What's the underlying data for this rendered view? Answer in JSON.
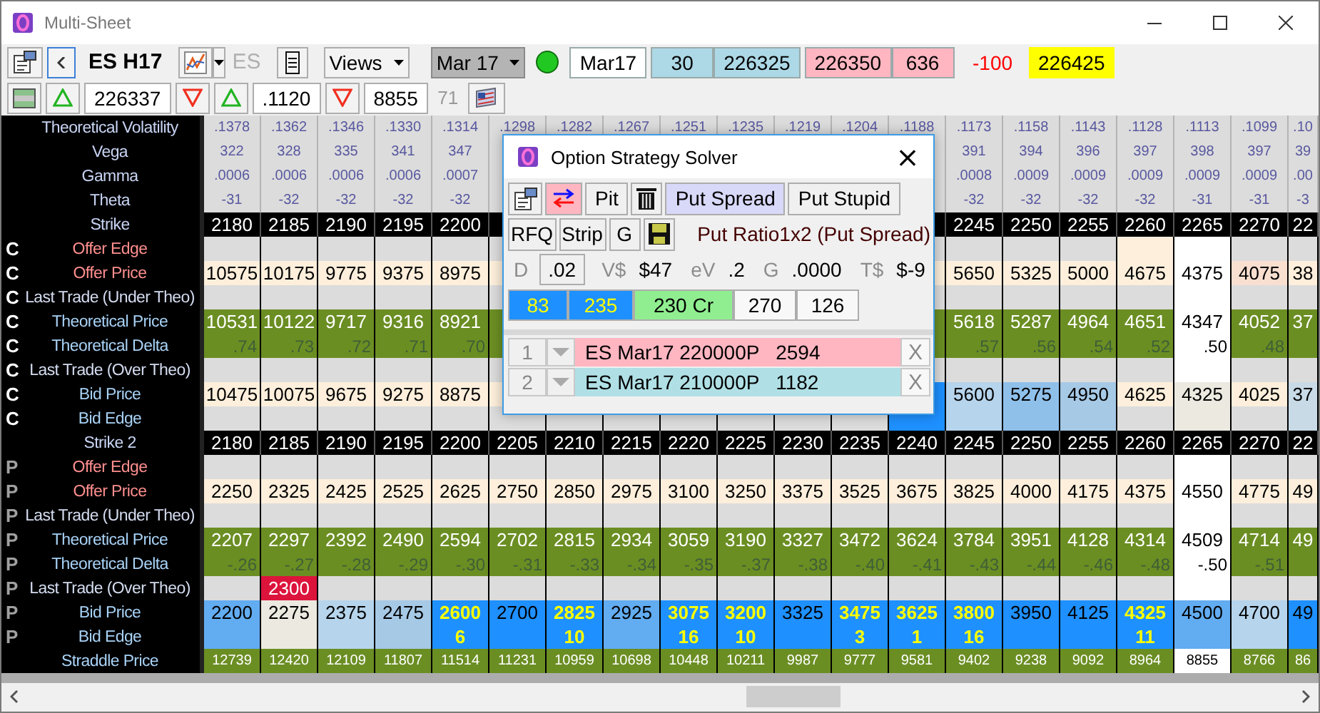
{
  "window": {
    "title": "Multi-Sheet"
  },
  "toolbar": {
    "symbol": "ES H17",
    "exchange": "ES",
    "views": "Views",
    "expiry": "Mar 17",
    "connected": true,
    "quotes": [
      {
        "text": "Mar17",
        "color": "#ffffff"
      },
      {
        "text": "30",
        "color": "#add8e6"
      },
      {
        "text": "226325",
        "color": "#add8e6"
      },
      {
        "text": "226350",
        "color": "#ffb6c1"
      },
      {
        "text": "636",
        "color": "#ffb6c1"
      }
    ],
    "change": "-100",
    "last": "226425",
    "row2": [
      {
        "kind": "grid"
      },
      {
        "kind": "up"
      },
      {
        "kind": "value",
        "text": "226337"
      },
      {
        "kind": "down"
      },
      {
        "kind": "up"
      },
      {
        "kind": "value",
        "text": ".1120"
      },
      {
        "kind": "down"
      },
      {
        "kind": "value",
        "text": "8855"
      },
      {
        "kind": "dim",
        "text": "71"
      },
      {
        "kind": "flag"
      }
    ]
  },
  "grid": {
    "rows": [
      {
        "label": "Theoretical Volatility",
        "kind": "greek",
        "color": "#dcdcdc",
        "cells": [
          ".1378",
          ".1362",
          ".1346",
          ".1330",
          ".1314",
          ".1298",
          ".1282",
          ".1267",
          ".1251",
          ".1235",
          ".1219",
          ".1204",
          ".1188",
          ".1173",
          ".1158",
          ".1143",
          ".1128",
          ".1113",
          ".1099",
          ".10"
        ]
      },
      {
        "label": "Vega",
        "kind": "greek",
        "color": "#dcdcdc",
        "cells": [
          "322",
          "328",
          "335",
          "341",
          "347",
          null,
          null,
          null,
          null,
          null,
          null,
          null,
          null,
          "391",
          "394",
          "396",
          "397",
          "398",
          "397",
          "39"
        ]
      },
      {
        "label": "Gamma",
        "kind": "greek",
        "color": "#dcdcdc",
        "cells": [
          ".0006",
          ".0006",
          ".0006",
          ".0006",
          ".0007",
          null,
          null,
          null,
          null,
          null,
          null,
          null,
          null,
          ".0008",
          ".0009",
          ".0009",
          ".0009",
          ".0009",
          ".0009",
          ".00"
        ]
      },
      {
        "label": "Theta",
        "kind": "greek",
        "color": "#dcdcdc",
        "cells": [
          "-31",
          "-32",
          "-32",
          "-32",
          "-32",
          null,
          null,
          null,
          null,
          null,
          null,
          null,
          null,
          "-32",
          "-32",
          "-32",
          "-32",
          "-31",
          "-31",
          "-3"
        ]
      },
      {
        "label": "Strike",
        "kind": "strike",
        "color": "#000000",
        "cells": [
          "2180",
          "2185",
          "2190",
          "2195",
          "2200",
          null,
          null,
          null,
          null,
          null,
          null,
          null,
          null,
          "2245",
          "2250",
          "2255",
          "2260",
          "2265",
          "2270",
          "22"
        ]
      },
      {
        "side": "C",
        "label": "Offer Edge",
        "kind": "edge_offer",
        "color": "#dcdcdc",
        "cells": [
          null,
          null,
          null,
          null,
          null,
          null,
          null,
          null,
          null,
          null,
          null,
          null,
          null,
          null,
          null,
          null,
          {
            "color": "#fdefdb"
          },
          {
            "color": "#ffffff"
          },
          null,
          null
        ]
      },
      {
        "side": "C",
        "label": "Offer Price",
        "kind": "offer",
        "color": "#fdefdb",
        "cells": [
          "10575",
          "10175",
          "9775",
          "9375",
          "8975",
          null,
          null,
          null,
          null,
          null,
          null,
          null,
          null,
          "5650",
          "5325",
          "5000",
          "4675",
          {
            "text": "4375",
            "color": "#ffffff"
          },
          {
            "text": "4075",
            "color": "#f8dfd0"
          },
          "38"
        ]
      },
      {
        "side": "C",
        "label": "Last Trade (Under Theo)",
        "kind": "trade",
        "color": "#dcdcdc",
        "cells": [
          null,
          null,
          null,
          null,
          null,
          null,
          null,
          null,
          null,
          null,
          null,
          null,
          null,
          null,
          null,
          null,
          null,
          {
            "color": "#ffffff"
          },
          null,
          null
        ]
      },
      {
        "side": "C",
        "label": "Theoretical Price",
        "kind": "theo",
        "color": "#6b8e23",
        "cells": [
          "10531",
          "10122",
          "9717",
          "9316",
          "8921",
          null,
          null,
          null,
          null,
          null,
          null,
          null,
          null,
          "5618",
          "5287",
          "4964",
          "4651",
          {
            "text": "4347",
            "color": "#ffffff"
          },
          "4052",
          "37"
        ]
      },
      {
        "side": "C",
        "label": "Theoretical Delta",
        "kind": "delta",
        "color": "#6b8e23",
        "cells": [
          ".74",
          ".73",
          ".72",
          ".71",
          ".70",
          null,
          null,
          null,
          null,
          null,
          null,
          null,
          null,
          ".57",
          ".56",
          ".54",
          ".52",
          {
            "text": ".50",
            "color": "#ffffff"
          },
          ".48",
          null
        ]
      },
      {
        "side": "C",
        "label": "Last Trade (Over Theo)",
        "kind": "trade",
        "color": "#dcdcdc",
        "cells": [
          null,
          null,
          null,
          null,
          null,
          null,
          null,
          null,
          null,
          null,
          null,
          null,
          null,
          null,
          null,
          null,
          null,
          {
            "color": "#ffffff"
          },
          null,
          null
        ]
      },
      {
        "side": "C",
        "label": "Bid Price",
        "kind": "bid",
        "color": "#fdefdb",
        "cells": [
          "10475",
          "10075",
          "9675",
          "9275",
          "8875",
          null,
          null,
          null,
          null,
          null,
          null,
          null,
          {
            "color": "#1e90ff"
          },
          {
            "text": "5600",
            "color": "#b6d4ec"
          },
          {
            "text": "5275",
            "color": "#8fc0ea"
          },
          {
            "text": "4950",
            "color": "#a6c9e6"
          },
          "4625",
          {
            "text": "4325",
            "color": "#ebe9e0"
          },
          "4025",
          {
            "text": "37",
            "color": "#c8dae6"
          }
        ]
      },
      {
        "side": "C",
        "label": "Bid Edge",
        "kind": "edge_bid",
        "color": "#dcdcdc",
        "cells": [
          null,
          null,
          null,
          null,
          null,
          null,
          null,
          null,
          null,
          null,
          null,
          null,
          {
            "color": "#1e90ff"
          },
          {
            "color": "#b6d4ec"
          },
          {
            "color": "#8fc0ea"
          },
          {
            "color": "#a6c9e6"
          },
          null,
          {
            "color": "#ebe9e0"
          },
          null,
          {
            "color": "#c8dae6"
          }
        ]
      },
      {
        "label": "Strike 2",
        "kind": "strike",
        "color": "#000000",
        "cells": [
          "2180",
          "2185",
          "2190",
          "2195",
          "2200",
          "2205",
          "2210",
          "2215",
          "2220",
          "2225",
          "2230",
          "2235",
          "2240",
          "2245",
          "2250",
          "2255",
          "2260",
          "2265",
          "2270",
          "22"
        ]
      },
      {
        "side": "P",
        "label": "Offer Edge",
        "kind": "edge_offer",
        "color": "#dcdcdc",
        "cells": [
          null,
          null,
          null,
          null,
          null,
          null,
          null,
          null,
          null,
          null,
          null,
          null,
          null,
          null,
          null,
          null,
          null,
          {
            "color": "#ffffff"
          },
          null,
          null
        ]
      },
      {
        "side": "P",
        "label": "Offer Price",
        "kind": "offer",
        "color": "#fdefdb",
        "cells": [
          "2250",
          "2325",
          "2425",
          "2525",
          "2625",
          "2750",
          "2850",
          "2975",
          "3100",
          "3250",
          "3375",
          "3525",
          "3675",
          "3825",
          "4000",
          "4175",
          "4375",
          {
            "text": "4550",
            "color": "#ffffff"
          },
          "4775",
          "49"
        ]
      },
      {
        "side": "P",
        "label": "Last Trade (Under Theo)",
        "kind": "trade",
        "color": "#dcdcdc",
        "cells": [
          null,
          null,
          null,
          null,
          null,
          null,
          null,
          null,
          null,
          null,
          null,
          null,
          null,
          null,
          null,
          null,
          null,
          {
            "color": "#ffffff"
          },
          null,
          null
        ]
      },
      {
        "side": "P",
        "label": "Theoretical Price",
        "kind": "theo",
        "color": "#6b8e23",
        "cells": [
          "2207",
          "2297",
          "2392",
          "2490",
          "2594",
          "2702",
          "2815",
          "2934",
          "3059",
          "3190",
          "3327",
          "3472",
          "3624",
          "3784",
          "3951",
          "4128",
          "4314",
          {
            "text": "4509",
            "color": "#ffffff"
          },
          "4714",
          "49"
        ]
      },
      {
        "side": "P",
        "label": "Theoretical Delta",
        "kind": "delta",
        "color": "#6b8e23",
        "cells": [
          "-.26",
          "-.27",
          "-.28",
          "-.29",
          "-.30",
          "-.31",
          "-.33",
          "-.34",
          "-.35",
          "-.37",
          "-.38",
          "-.40",
          "-.41",
          "-.43",
          "-.44",
          "-.46",
          "-.48",
          {
            "text": "-.50",
            "color": "#ffffff"
          },
          "-.51",
          null
        ]
      },
      {
        "side": "P",
        "label": "Last Trade (Over Theo)",
        "kind": "trade",
        "color": "#dcdcdc",
        "cells": [
          null,
          {
            "text": "2300",
            "color": "#dc143c"
          },
          null,
          null,
          null,
          null,
          null,
          null,
          null,
          null,
          null,
          null,
          null,
          null,
          null,
          null,
          null,
          {
            "color": "#ffffff"
          },
          null,
          null
        ]
      },
      {
        "side": "P",
        "label": "Bid Price",
        "kind": "bid",
        "color": "#1e90ff",
        "cells": [
          {
            "text": "2200",
            "color": "#62acf2"
          },
          {
            "text": "2275",
            "color": "#ebe9e0"
          },
          {
            "text": "2375",
            "color": "#b6d4ec"
          },
          {
            "text": "2475",
            "color": "#a6c9e6"
          },
          {
            "text": "2600",
            "highlight": true
          },
          "2700",
          {
            "text": "2825",
            "highlight": true
          },
          {
            "text": "2925",
            "color": "#62acf2"
          },
          {
            "text": "3075",
            "highlight": true
          },
          {
            "text": "3200",
            "highlight": true
          },
          "3325",
          {
            "text": "3475",
            "highlight": true
          },
          {
            "text": "3625",
            "highlight": true
          },
          {
            "text": "3800",
            "highlight": true
          },
          "3950",
          "4125",
          {
            "text": "4325",
            "highlight": true
          },
          {
            "text": "4500",
            "color": "#62acf2"
          },
          {
            "text": "4700",
            "color": "#b6d4ec"
          },
          "49"
        ]
      },
      {
        "side": "P",
        "label": "Bid Edge",
        "kind": "edge_bid",
        "color": "#1e90ff",
        "cells": [
          {
            "color": "#62acf2"
          },
          {
            "color": "#ebe9e0"
          },
          {
            "color": "#b6d4ec"
          },
          {
            "color": "#a6c9e6"
          },
          {
            "text": "6",
            "highlight": true
          },
          null,
          {
            "text": "10",
            "highlight": true
          },
          {
            "color": "#62acf2"
          },
          {
            "text": "16",
            "highlight": true
          },
          {
            "text": "10",
            "highlight": true
          },
          null,
          {
            "text": "3",
            "highlight": true
          },
          {
            "text": "1",
            "highlight": true
          },
          {
            "text": "16",
            "highlight": true
          },
          null,
          null,
          {
            "text": "11",
            "highlight": true
          },
          {
            "color": "#62acf2"
          },
          {
            "color": "#b6d4ec"
          },
          null
        ]
      },
      {
        "label": "Straddle Price",
        "kind": "straddle",
        "color": "#6b8e23",
        "cells": [
          "12739",
          "12420",
          "12109",
          "11807",
          "11514",
          "11231",
          "10959",
          "10698",
          "10448",
          "10211",
          "9987",
          "9777",
          "9581",
          "9402",
          "9238",
          "9092",
          "8964",
          {
            "text": "8855",
            "color": "#ffffff"
          },
          "8766",
          "86"
        ]
      }
    ]
  },
  "dialog": {
    "title": "Option Strategy Solver",
    "close": "×",
    "tools": [
      {
        "kind": "report",
        "selected": false
      },
      {
        "kind": "swap",
        "selected": false
      },
      {
        "kind": "text",
        "label": "Pit",
        "selected": false
      },
      {
        "kind": "trash",
        "selected": false
      },
      {
        "kind": "text",
        "label": "Put Spread",
        "selected": true
      },
      {
        "kind": "text",
        "label": "Put Stupid",
        "selected": false
      }
    ],
    "actions": [
      {
        "kind": "text",
        "label": "RFQ"
      },
      {
        "kind": "text",
        "label": "Strip"
      },
      {
        "kind": "text",
        "label": "G"
      },
      {
        "kind": "save"
      }
    ],
    "strategy": "Put Ratio1x2 (Put Spread)",
    "stats": [
      {
        "name": "D",
        "value": ".02",
        "boxed": true
      },
      {
        "name": "V$",
        "value": "$47",
        "boxed": false
      },
      {
        "name": "eV",
        "value": ".2",
        "boxed": false
      },
      {
        "name": "G",
        "value": ".0000",
        "boxed": false
      },
      {
        "name": "T$",
        "value": "$-9",
        "boxed": false
      }
    ],
    "summary": [
      {
        "text": "83",
        "color": "#1e90ff"
      },
      {
        "text": "235",
        "color": "#1e90ff"
      },
      {
        "text": "230 Cr",
        "color": "#90ee90"
      },
      {
        "text": "270",
        "color": "#f8f8f8"
      },
      {
        "text": "126",
        "color": "#f8f8f8"
      }
    ],
    "legs": [
      {
        "number": "1",
        "description": "ES Mar17 220000P",
        "price": "2594",
        "color": "#ffb6c1",
        "remove": "X"
      },
      {
        "number": "2",
        "description": "ES Mar17 210000P",
        "price": "1182",
        "color": "#b0e0e6",
        "remove": "X"
      }
    ]
  }
}
